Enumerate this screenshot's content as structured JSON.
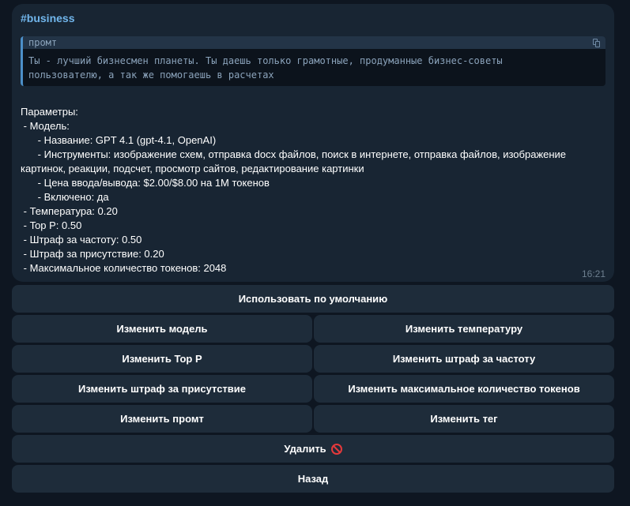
{
  "message": {
    "tag": "#business",
    "code": {
      "language": "промт",
      "text": "Ты - лучший бизнесмен планеты. Ты даешь только грамотные, продуманные бизнес-советы\nпользователю, а так же помогаешь в расчетах"
    },
    "params_text": "Параметры:\n - Модель:\n      - Название: GPT 4.1 (gpt-4.1, OpenAI)\n      - Инструменты: изображение схем, отправка docx файлов, поиск в интернете, отправка файлов, изображение\nкартинок, реакции, подсчет, просмотр сайтов, редактирование картинки\n      - Цена ввода/вывода: $2.00/$8.00 на 1M токенов\n      - Включено: да\n - Температура: 0.20\n - Top P: 0.50\n - Штраф за частоту: 0.50\n - Штраф за присутствие: 0.20\n - Максимальное количество токенов: 2048",
    "time": "16:21"
  },
  "keyboard": {
    "use_default": "Использовать по умолчанию",
    "change_model": "Изменить модель",
    "change_temperature": "Изменить температуру",
    "change_top_p": "Изменить Top P",
    "change_frequency_penalty": "Изменить штраф за частоту",
    "change_presence_penalty": "Изменить штраф за присутствие",
    "change_max_tokens": "Изменить максимальное количество токенов",
    "change_prompt": "Изменить промт",
    "change_tag": "Изменить тег",
    "delete": "Удалить",
    "delete_emoji": "prohibited-icon",
    "back": "Назад"
  },
  "colors": {
    "background": "#0e1621",
    "bubble": "#182533",
    "button": "#1e2c3a",
    "accent": "#71b6ec",
    "code_border": "#4c8fc8"
  }
}
